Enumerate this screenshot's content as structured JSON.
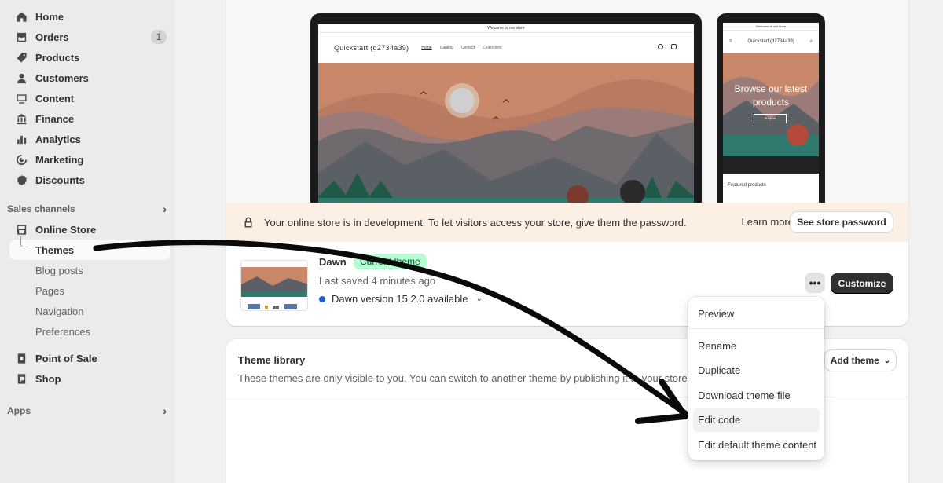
{
  "sidebar": {
    "items": [
      {
        "label": "Home",
        "icon": "home-icon"
      },
      {
        "label": "Orders",
        "icon": "orders-icon",
        "badge": "1"
      },
      {
        "label": "Products",
        "icon": "tag-icon"
      },
      {
        "label": "Customers",
        "icon": "person-icon"
      },
      {
        "label": "Content",
        "icon": "content-icon"
      },
      {
        "label": "Finance",
        "icon": "bank-icon"
      },
      {
        "label": "Analytics",
        "icon": "bar-chart-icon"
      },
      {
        "label": "Marketing",
        "icon": "target-icon"
      },
      {
        "label": "Discounts",
        "icon": "discount-icon"
      }
    ],
    "sales_channels_label": "Sales channels",
    "online_store": "Online Store",
    "sub_items": [
      "Themes",
      "Blog posts",
      "Pages",
      "Navigation",
      "Preferences"
    ],
    "point_of_sale": "Point of Sale",
    "shop": "Shop",
    "apps_label": "Apps"
  },
  "preview": {
    "announcement": "Welcome to our store",
    "store_name": "Quickstart (d2734a39)",
    "menu": [
      "Home",
      "Catalog",
      "Contact",
      "Collections"
    ],
    "phone_hero_text": "Browse our latest products",
    "phone_shop_button": "Shop all",
    "phone_featured": "Featured products"
  },
  "banner": {
    "text": "Your online store is in development. To let visitors access your store, give them the password.",
    "learn_more": "Learn more",
    "see_password": "See store password"
  },
  "current_theme": {
    "name": "Dawn",
    "badge": "Current theme",
    "saved": "Last saved 4 minutes ago",
    "version": "Dawn version 15.2.0 available",
    "more_label": "•••",
    "customize": "Customize"
  },
  "library": {
    "title": "Theme library",
    "description": "These themes are only visible to you. You can switch to another theme by publishing it to your store.",
    "add_theme": "Add theme"
  },
  "menu": {
    "items": [
      "Preview",
      "Rename",
      "Duplicate",
      "Download theme file",
      "Edit code",
      "Edit default theme content"
    ],
    "highlighted": "Edit code"
  },
  "colors": {
    "accent_dark": "#303030",
    "badge_green": "#b4fed2",
    "banner_bg": "#fcefe3",
    "version_dot": "#1c63c9"
  }
}
